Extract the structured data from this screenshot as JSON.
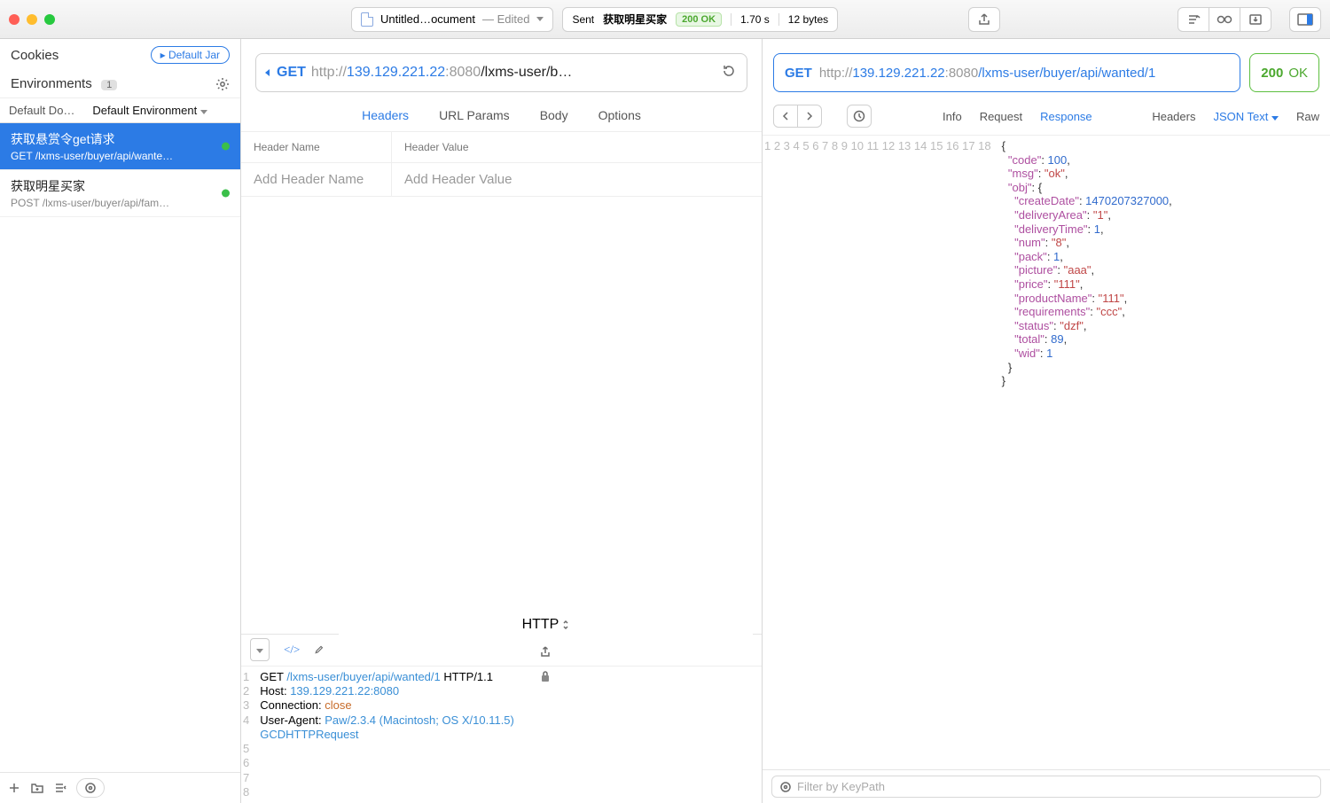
{
  "titlebar": {
    "doc_name": "Untitled…ocument",
    "edited": "— Edited",
    "sent_label": "Sent",
    "sent_name": "获取明星买家",
    "status_code": "200 OK",
    "time": "1.70 s",
    "size": "12 bytes"
  },
  "sidebar": {
    "cookies": "Cookies",
    "default_jar": "Default Jar",
    "environments": "Environments",
    "env_count": "1",
    "tab_default": "Default Do…",
    "tab_env": "Default Environment",
    "items": [
      {
        "title": "获取悬赏令get请求",
        "sub": "GET /lxms-user/buyer/api/wante…"
      },
      {
        "title": "获取明星买家",
        "sub": "POST /lxms-user/buyer/api/fam…"
      }
    ]
  },
  "request": {
    "method": "GET",
    "url_scheme": "http://",
    "url_host": "139.129.221.22",
    "url_port": ":8080",
    "url_path": "/lxms-user/b…",
    "tabs": {
      "headers": "Headers",
      "params": "URL Params",
      "body": "Body",
      "options": "Options"
    },
    "hdr_name_label": "Header Name",
    "hdr_value_label": "Header Value",
    "hdr_name_ph": "Add Header Name",
    "hdr_value_ph": "Add Header Value",
    "codebar_type": "HTTP",
    "raw": {
      "l1a": "GET ",
      "l1b": "/lxms-user/buyer/api/wanted/1",
      "l1c": " HTTP/1.1",
      "l2a": "Host: ",
      "l2b": "139.129.221.22:8080",
      "l3a": "Connection: ",
      "l3b": "close",
      "l4a": "User-Agent: ",
      "l4b": "Paw/2.3.4 (Macintosh; OS X/10.11.5)",
      "l5": "GCDHTTPRequest"
    }
  },
  "response": {
    "method": "GET",
    "url_scheme": "http://",
    "url_host": "139.129.221.22",
    "url_port": ":8080",
    "url_path": "/lxms-user/buyer/api/wanted/1",
    "status_num": "200",
    "status_txt": "OK",
    "tabs": {
      "info": "Info",
      "request": "Request",
      "response": "Response",
      "headers": "Headers",
      "jsontext": "JSON Text",
      "raw": "Raw"
    },
    "json_lines": [
      [
        [
          "p",
          "{"
        ]
      ],
      [
        [
          "sp",
          "  "
        ],
        [
          "k",
          "\"code\""
        ],
        [
          "p",
          ": "
        ],
        [
          "n",
          "100"
        ],
        [
          "p",
          ","
        ]
      ],
      [
        [
          "sp",
          "  "
        ],
        [
          "k",
          "\"msg\""
        ],
        [
          "p",
          ": "
        ],
        [
          "s",
          "\"ok\""
        ],
        [
          "p",
          ","
        ]
      ],
      [
        [
          "sp",
          "  "
        ],
        [
          "k",
          "\"obj\""
        ],
        [
          "p",
          ": {"
        ]
      ],
      [
        [
          "sp",
          "    "
        ],
        [
          "k",
          "\"createDate\""
        ],
        [
          "p",
          ": "
        ],
        [
          "n",
          "1470207327000"
        ],
        [
          "p",
          ","
        ]
      ],
      [
        [
          "sp",
          "    "
        ],
        [
          "k",
          "\"deliveryArea\""
        ],
        [
          "p",
          ": "
        ],
        [
          "s",
          "\"1\""
        ],
        [
          "p",
          ","
        ]
      ],
      [
        [
          "sp",
          "    "
        ],
        [
          "k",
          "\"deliveryTime\""
        ],
        [
          "p",
          ": "
        ],
        [
          "n",
          "1"
        ],
        [
          "p",
          ","
        ]
      ],
      [
        [
          "sp",
          "    "
        ],
        [
          "k",
          "\"num\""
        ],
        [
          "p",
          ": "
        ],
        [
          "s",
          "\"8\""
        ],
        [
          "p",
          ","
        ]
      ],
      [
        [
          "sp",
          "    "
        ],
        [
          "k",
          "\"pack\""
        ],
        [
          "p",
          ": "
        ],
        [
          "n",
          "1"
        ],
        [
          "p",
          ","
        ]
      ],
      [
        [
          "sp",
          "    "
        ],
        [
          "k",
          "\"picture\""
        ],
        [
          "p",
          ": "
        ],
        [
          "s",
          "\"aaa\""
        ],
        [
          "p",
          ","
        ]
      ],
      [
        [
          "sp",
          "    "
        ],
        [
          "k",
          "\"price\""
        ],
        [
          "p",
          ": "
        ],
        [
          "s",
          "\"111\""
        ],
        [
          "p",
          ","
        ]
      ],
      [
        [
          "sp",
          "    "
        ],
        [
          "k",
          "\"productName\""
        ],
        [
          "p",
          ": "
        ],
        [
          "s",
          "\"111\""
        ],
        [
          "p",
          ","
        ]
      ],
      [
        [
          "sp",
          "    "
        ],
        [
          "k",
          "\"requirements\""
        ],
        [
          "p",
          ": "
        ],
        [
          "s",
          "\"ccc\""
        ],
        [
          "p",
          ","
        ]
      ],
      [
        [
          "sp",
          "    "
        ],
        [
          "k",
          "\"status\""
        ],
        [
          "p",
          ": "
        ],
        [
          "s",
          "\"dzf\""
        ],
        [
          "p",
          ","
        ]
      ],
      [
        [
          "sp",
          "    "
        ],
        [
          "k",
          "\"total\""
        ],
        [
          "p",
          ": "
        ],
        [
          "n",
          "89"
        ],
        [
          "p",
          ","
        ]
      ],
      [
        [
          "sp",
          "    "
        ],
        [
          "k",
          "\"wid\""
        ],
        [
          "p",
          ": "
        ],
        [
          "n",
          "1"
        ]
      ],
      [
        [
          "sp",
          "  "
        ],
        [
          "p",
          "}"
        ]
      ],
      [
        [
          "p",
          "}"
        ]
      ]
    ],
    "filter_ph": "Filter by KeyPath"
  }
}
